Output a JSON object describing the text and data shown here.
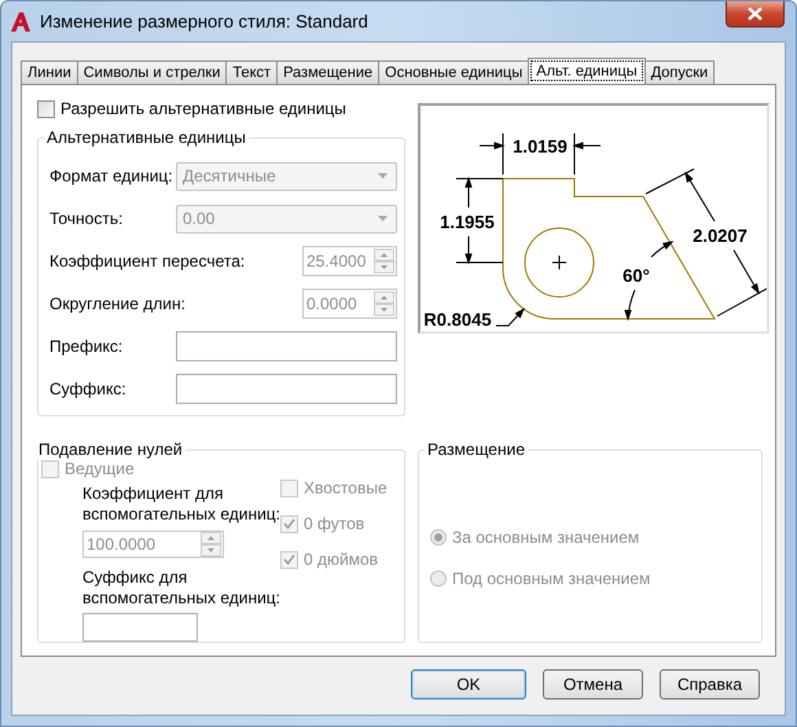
{
  "window": {
    "title": "Изменение размерного стиля: Standard"
  },
  "tabs": [
    {
      "label": "Линии",
      "selected": false
    },
    {
      "label": "Символы и стрелки",
      "selected": false
    },
    {
      "label": "Текст",
      "selected": false
    },
    {
      "label": "Размещение",
      "selected": false
    },
    {
      "label": "Основные единицы",
      "selected": false
    },
    {
      "label": "Альт. единицы",
      "selected": true
    },
    {
      "label": "Допуски",
      "selected": false
    }
  ],
  "enable_alt_units": {
    "label": "Разрешить альтернативные единицы",
    "checked": false,
    "disabled": false
  },
  "alt_units": {
    "title": "Альтернативные единицы",
    "rows": [
      {
        "kind": "combo",
        "label": "Формат единиц:",
        "value": "Десятичные",
        "disabled": true
      },
      {
        "kind": "combo",
        "label": "Точность:",
        "value": "0.00",
        "disabled": true
      },
      {
        "kind": "spin",
        "label": "Коэффициент пересчета:",
        "value": "25.4000",
        "disabled": true
      },
      {
        "kind": "spin",
        "label": "Округление длин:",
        "value": "0.0000",
        "disabled": true
      },
      {
        "kind": "text",
        "label": "Префикс:",
        "disabled": false
      },
      {
        "kind": "text",
        "label": "Суффикс:",
        "disabled": false
      }
    ]
  },
  "preview": {
    "labels": [
      "1.0159",
      "1.1955",
      "2.0207",
      "60°",
      "R0.8045"
    ]
  },
  "zero_suppression": {
    "title": "Подавление нулей",
    "leading": {
      "label": "Ведущие",
      "checked": false,
      "disabled": true
    },
    "sub_unit_factor": {
      "label": "Коэффициент для вспомогательных единиц:",
      "value": "100.0000",
      "disabled": true
    },
    "sub_unit_suffix": {
      "label": "Суффикс для вспомогательных единиц:"
    },
    "options": [
      {
        "label": "Хвостовые",
        "checked": false,
        "disabled": true
      },
      {
        "label": "0 футов",
        "checked": true,
        "disabled": true
      },
      {
        "label": "0 дюймов",
        "checked": true,
        "disabled": true
      }
    ]
  },
  "placement": {
    "title": "Размещение",
    "options": [
      {
        "label": "За основным значением",
        "selected": true,
        "disabled": true
      },
      {
        "label": "Под основным значением",
        "selected": false,
        "disabled": true
      }
    ]
  },
  "buttons": [
    {
      "label": "OK",
      "default": true
    },
    {
      "label": "Отмена",
      "default": false
    },
    {
      "label": "Справка",
      "default": false
    }
  ]
}
